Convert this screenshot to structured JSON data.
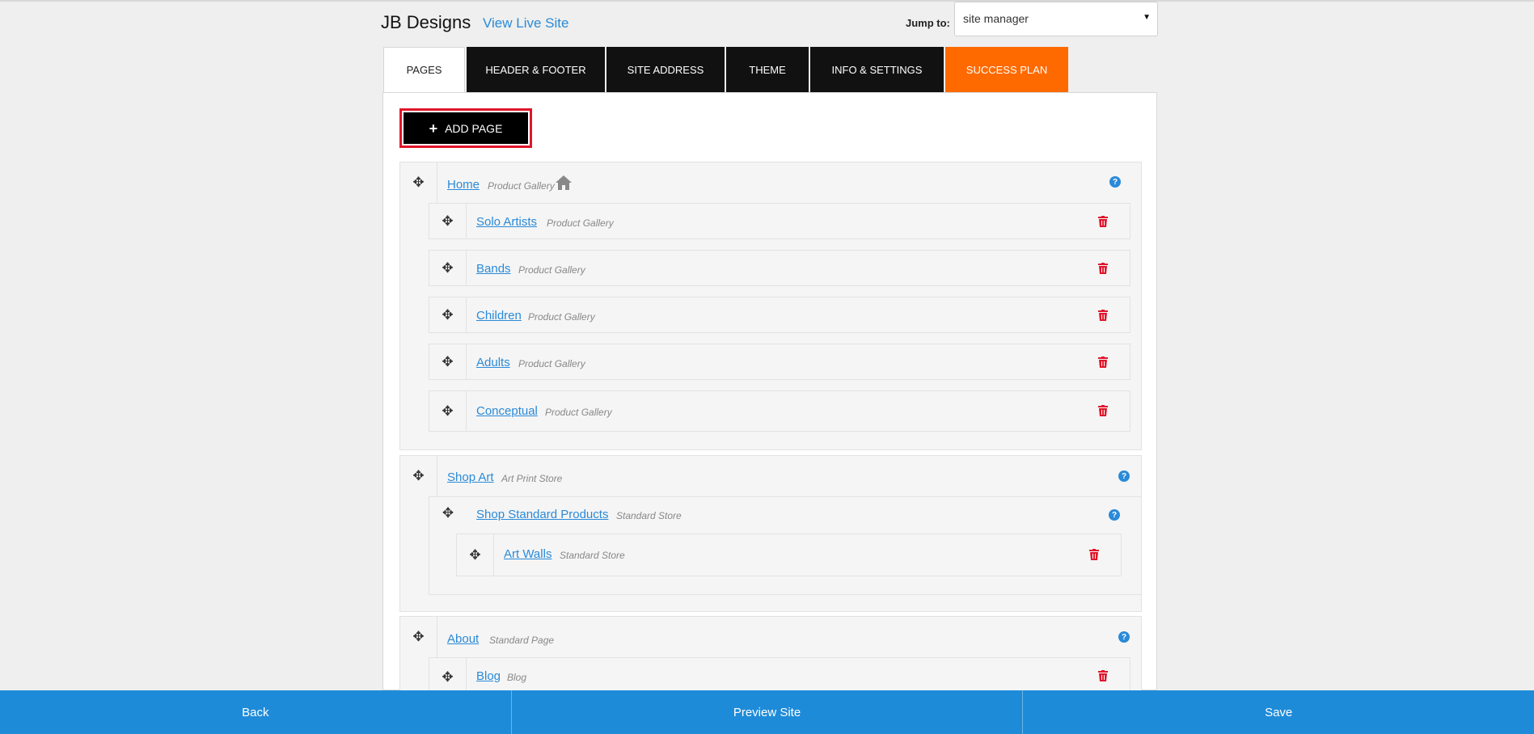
{
  "header": {
    "site_name": "JB Designs",
    "live_link": "View Live Site",
    "jump_label": "Jump to:",
    "jump_value": "site manager"
  },
  "tabs": [
    {
      "label": "PAGES"
    },
    {
      "label": "HEADER & FOOTER"
    },
    {
      "label": "SITE ADDRESS"
    },
    {
      "label": "THEME"
    },
    {
      "label": "INFO & SETTINGS"
    },
    {
      "label": "SUCCESS PLAN"
    }
  ],
  "add_page": "ADD PAGE",
  "pages": {
    "home": {
      "name": "Home",
      "type": "Product Gallery"
    },
    "solo": {
      "name": "Solo Artists",
      "type": "Product Gallery"
    },
    "bands": {
      "name": "Bands",
      "type": "Product Gallery"
    },
    "children": {
      "name": "Children",
      "type": "Product Gallery"
    },
    "adults": {
      "name": "Adults",
      "type": "Product Gallery"
    },
    "conceptual": {
      "name": "Conceptual",
      "type": "Product Gallery"
    },
    "shop_art": {
      "name": "Shop Art",
      "type": "Art Print Store"
    },
    "shop_std": {
      "name": "Shop Standard Products",
      "type": "Standard Store"
    },
    "art_walls": {
      "name": "Art Walls",
      "type": "Standard Store"
    },
    "about": {
      "name": "About",
      "type": "Standard Page"
    },
    "blog": {
      "name": "Blog",
      "type": "Blog"
    }
  },
  "footer": {
    "back": "Back",
    "preview": "Preview Site",
    "save": "Save"
  },
  "colors": {
    "link": "#2a8ad8",
    "accent_orange": "#ff6a00",
    "footer_blue": "#1e8bd8",
    "delete_red": "#e0162b"
  }
}
